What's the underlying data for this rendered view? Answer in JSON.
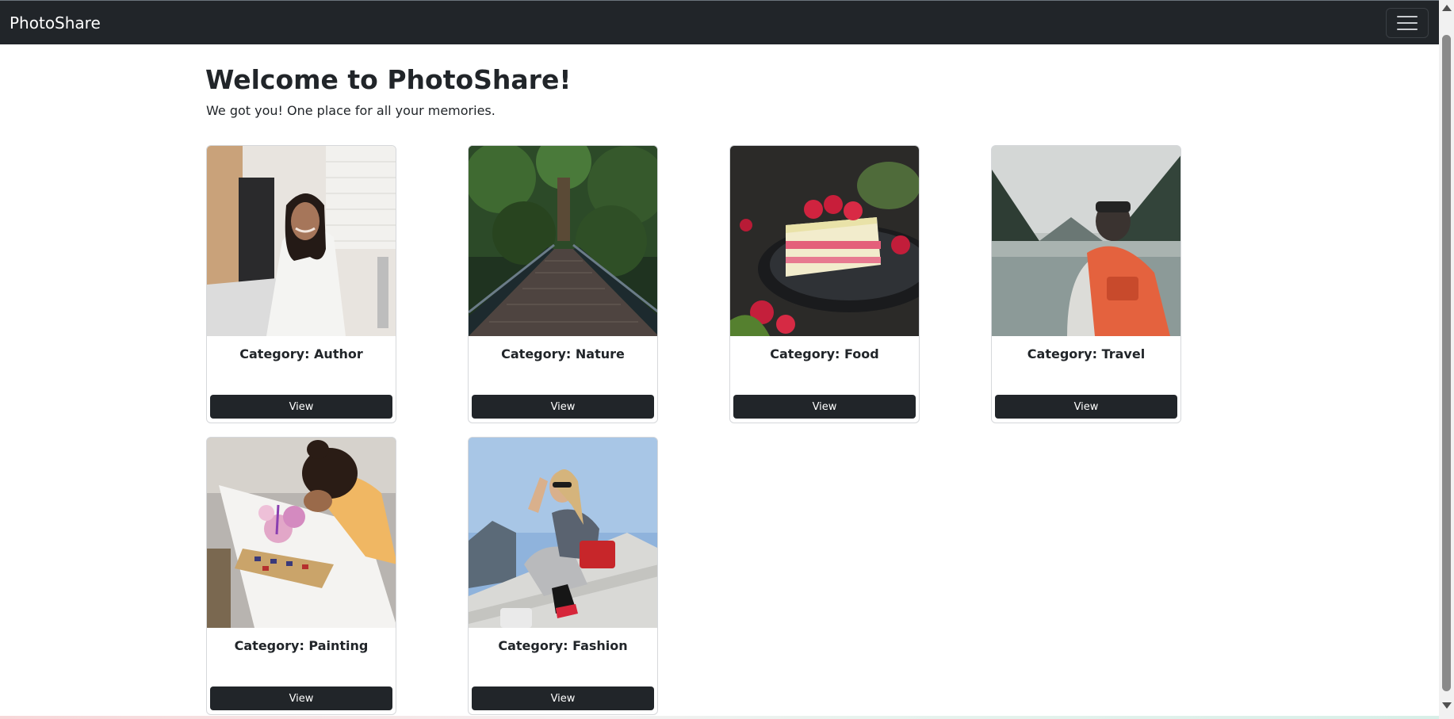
{
  "navbar": {
    "brand": "PhotoShare",
    "toggle_icon": "hamburger-icon"
  },
  "hero": {
    "title": "Welcome to PhotoShare!",
    "subtitle": "We got you! One place for all your memories."
  },
  "cards": [
    {
      "category": "Category: Author",
      "button": "View",
      "image": "smiling-woman-at-desk"
    },
    {
      "category": "Category: Nature",
      "button": "View",
      "image": "forest-bridge"
    },
    {
      "category": "Category: Food",
      "button": "View",
      "image": "raspberry-cake-slice"
    },
    {
      "category": "Category: Travel",
      "button": "View",
      "image": "hiker-at-mountain-lake"
    },
    {
      "category": "Category: Painting",
      "button": "View",
      "image": "woman-painting-watercolor"
    },
    {
      "category": "Category: Fashion",
      "button": "View",
      "image": "woman-posing-on-ledge"
    }
  ],
  "colors": {
    "navbar": "#212529",
    "button": "#212529",
    "text": "#212529",
    "background": "#ffffff"
  }
}
